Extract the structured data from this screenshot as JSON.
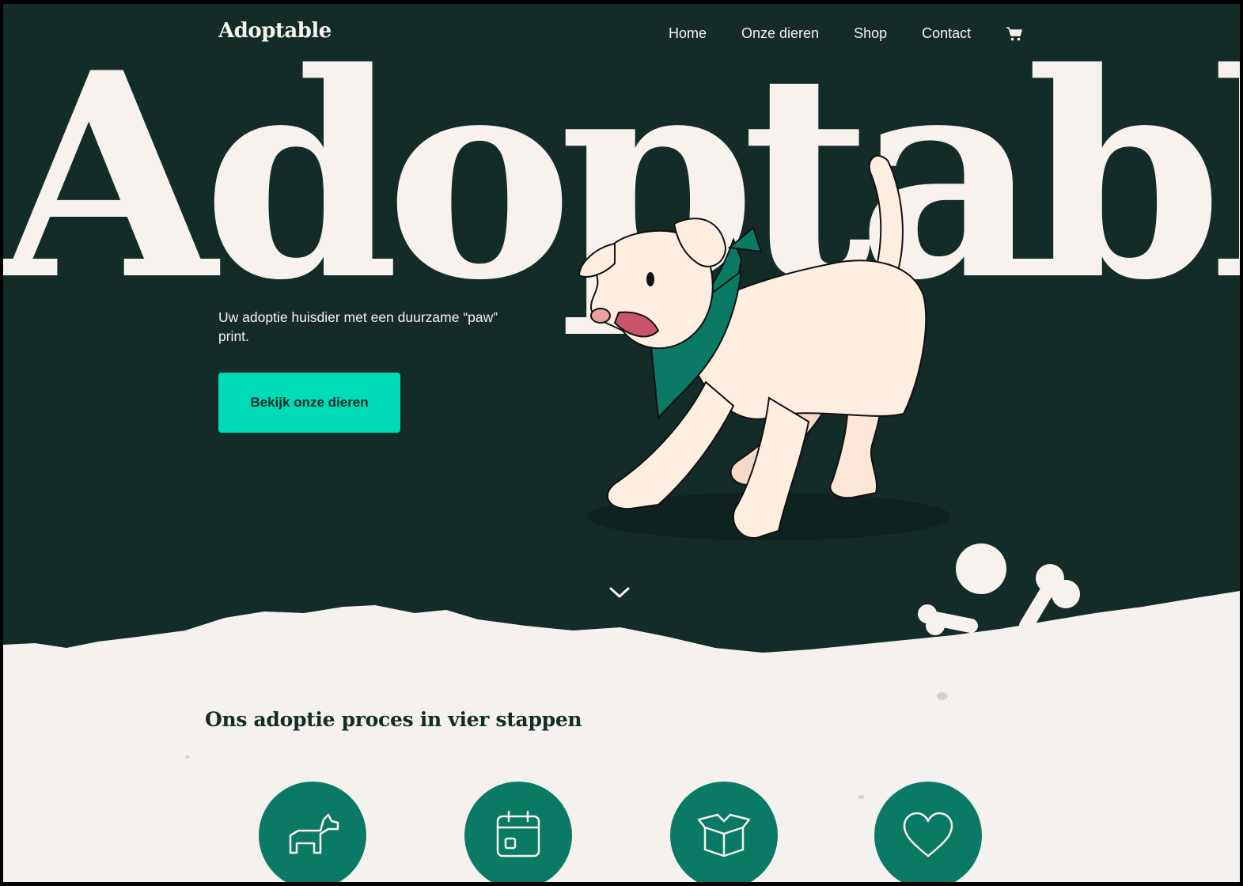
{
  "brand": {
    "logo": "Adoptable"
  },
  "nav": {
    "items": [
      "Home",
      "Onze dieren",
      "Shop",
      "Contact"
    ],
    "cart_icon": "cart-icon"
  },
  "hero": {
    "big_title": "Adoptable",
    "tagline": "Uw adoptie huisdier met een duurzame “paw” print.",
    "cta_label": "Bekijk onze dieren",
    "scroll_icon": "chevron-down-icon"
  },
  "process": {
    "title": "Ons adoptie proces in vier stappen",
    "steps": [
      {
        "icon": "dog-icon"
      },
      {
        "icon": "calendar-icon"
      },
      {
        "icon": "box-icon"
      },
      {
        "icon": "heart-icon"
      }
    ]
  },
  "colors": {
    "hero_bg": "#132c27",
    "accent": "#00dbb7",
    "step_circle": "#0b7a65",
    "paper": "#f4f1ee"
  }
}
